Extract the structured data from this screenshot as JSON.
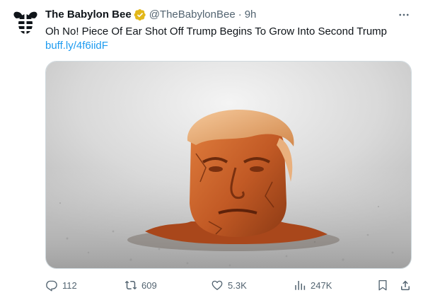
{
  "tweet": {
    "display_name": "The Babylon Bee",
    "handle": "@TheBabylonBee",
    "separator": "·",
    "time": "9h",
    "text": "Oh No! Piece Of Ear Shot Off Trump Begins To Grow Into Second Trump",
    "link": "buff.ly/4f6iidF"
  },
  "actions": {
    "replies": "112",
    "retweets": "609",
    "likes": "5.3K",
    "views": "247K"
  },
  "icons": {
    "avatar": "babylon-bee-logo",
    "verified": "verified-badge",
    "more": "more-icon",
    "reply": "reply-icon",
    "retweet": "retweet-icon",
    "like": "heart-icon",
    "views": "views-icon",
    "bookmark": "bookmark-icon",
    "share": "share-icon"
  },
  "colors": {
    "verified": "#e2b719",
    "link": "#1d9bf0",
    "secondary_text": "#536471",
    "primary_text": "#0f1419"
  }
}
